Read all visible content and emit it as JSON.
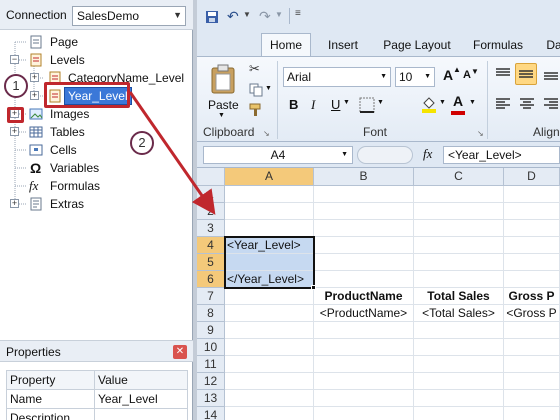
{
  "connection": {
    "label": "Connection",
    "value": "SalesDemo"
  },
  "tree": {
    "page": "Page",
    "levels": "Levels",
    "category_level": "CategoryName_Level",
    "year_level": "Year_Level",
    "images": "Images",
    "tables": "Tables",
    "cells": "Cells",
    "variables": "Variables",
    "formulas": "Formulas",
    "extras": "Extras",
    "variables_glyph": "Ω",
    "formulas_glyph": "fx"
  },
  "callouts": {
    "one": "1",
    "two": "2"
  },
  "properties": {
    "title": "Properties",
    "headers": [
      "Property",
      "Value"
    ],
    "rows": [
      [
        "Name",
        "Year_Level"
      ],
      [
        "Description",
        ""
      ]
    ]
  },
  "ribbon": {
    "tabs": [
      "Home",
      "Insert",
      "Page Layout",
      "Formulas",
      "Da"
    ],
    "active_tab": "Home",
    "paste_label": "Paste",
    "clipboard_label": "Clipboard",
    "font_group_label": "Font",
    "alignment_label": "Align",
    "font_name": "Arial",
    "font_size": "10",
    "grow_font": "A",
    "shrink_font": "A",
    "bold": "B",
    "italic": "I",
    "underline": "U",
    "font_color_glyph": "A"
  },
  "formula_bar": {
    "name_box": "A4",
    "fx_glyph": "fx",
    "content": "<Year_Level>"
  },
  "sheet": {
    "columns": [
      "A",
      "B",
      "C",
      "D"
    ],
    "rows": [
      "1",
      "2",
      "3",
      "4",
      "5",
      "6",
      "7",
      "8",
      "9",
      "10",
      "11",
      "12",
      "13",
      "14"
    ],
    "cells": {
      "A4": "<Year_Level>",
      "A6": "</Year_Level>",
      "B7": "ProductName",
      "C7": "Total Sales",
      "D7": "Gross P",
      "B8": "<ProductName>",
      "C8": "<Total Sales>",
      "D8": "<Gross P"
    }
  },
  "colors": {
    "accent_red": "#c0272d",
    "selection_blue": "#3b78d8",
    "range_fill": "#c6d9f1"
  }
}
